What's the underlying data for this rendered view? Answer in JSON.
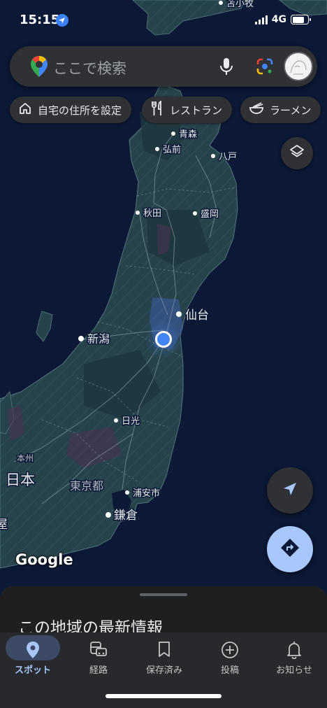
{
  "status_bar": {
    "time": "15:15",
    "network": "4G"
  },
  "search": {
    "placeholder": "ここで検索"
  },
  "chips": [
    {
      "label": "自宅の住所を設定",
      "icon": "home-icon"
    },
    {
      "label": "レストラン",
      "icon": "restaurant-icon"
    },
    {
      "label": "ラーメン",
      "icon": "ramen-icon"
    }
  ],
  "map": {
    "labels": {
      "tomakomai": "苫小牧",
      "aomori": "青森",
      "hirosaki": "弘前",
      "hachinohe": "八戸",
      "akita": "秋田",
      "morioka": "盛岡",
      "sendai": "仙台",
      "niigata": "新潟",
      "nikko": "日光",
      "honshu": "本州",
      "japan": "日本",
      "tokyo": "東京都",
      "urayasu": "浦安市",
      "kamakura": "鎌倉",
      "edge_partial": "屋"
    },
    "logo": "Google"
  },
  "sheet": {
    "title": "この地域の最新情報"
  },
  "nav": [
    {
      "label": "スポット",
      "icon": "place-icon",
      "active": true
    },
    {
      "label": "経路",
      "icon": "commute-icon",
      "active": false
    },
    {
      "label": "保存済み",
      "icon": "bookmark-icon",
      "active": false
    },
    {
      "label": "投稿",
      "icon": "add-circle-icon",
      "active": false
    },
    {
      "label": "お知らせ",
      "icon": "bell-icon",
      "active": false
    }
  ],
  "colors": {
    "ocean": "#0b1836",
    "land": "#26424a",
    "accent": "#a8c7fa",
    "location_dot": "#4285f4"
  }
}
